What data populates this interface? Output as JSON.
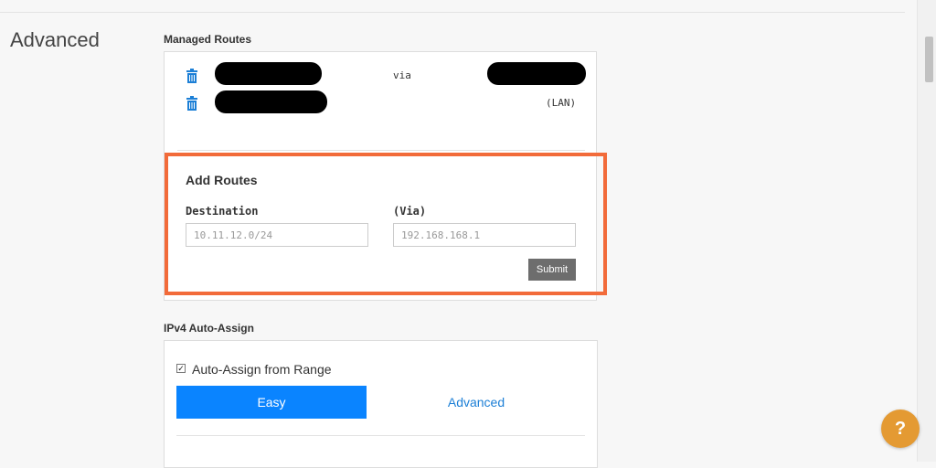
{
  "section": {
    "title": "Advanced"
  },
  "managed_routes": {
    "label": "Managed Routes",
    "rows": [
      {
        "via_text": "via",
        "note": ""
      },
      {
        "via_text": "",
        "note": "(LAN)"
      }
    ]
  },
  "add_routes": {
    "title": "Add Routes",
    "destination_label": "Destination",
    "destination_placeholder": "10.11.12.0/24",
    "via_label": "(Via)",
    "via_placeholder": "192.168.168.1",
    "submit_label": "Submit"
  },
  "ipv4": {
    "label": "IPv4 Auto-Assign",
    "checkbox_label": "Auto-Assign from Range",
    "checkbox_checked": true,
    "tabs": [
      {
        "label": "Easy",
        "active": true
      },
      {
        "label": "Advanced",
        "active": false
      }
    ]
  },
  "help": {
    "label": "?"
  },
  "colors": {
    "accent": "#0a84ff",
    "highlight": "#f26b3a",
    "help": "#e49a33"
  }
}
